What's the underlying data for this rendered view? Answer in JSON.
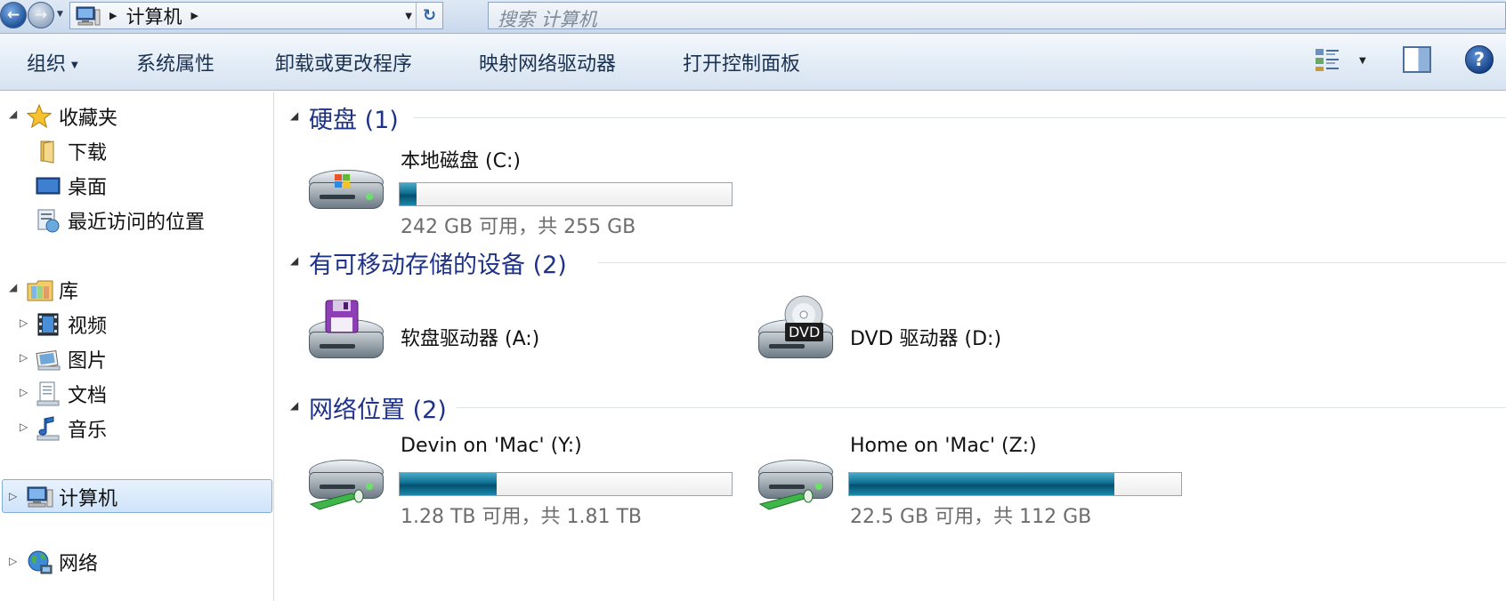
{
  "address": {
    "breadcrumb": "计算机",
    "search_placeholder": "搜索 计算机"
  },
  "toolbar": {
    "organize": "组织",
    "system_properties": "系统属性",
    "uninstall": "卸载或更改程序",
    "map_drive": "映射网络驱动器",
    "control_panel": "打开控制面板"
  },
  "nav": {
    "favorites": "收藏夹",
    "downloads": "下载",
    "desktop": "桌面",
    "recent": "最近访问的位置",
    "libraries": "库",
    "videos": "视频",
    "pictures": "图片",
    "documents": "文档",
    "music": "音乐",
    "computer": "计算机",
    "network": "网络"
  },
  "groups": {
    "hdd": "硬盘 (1)",
    "removable": "有可移动存储的设备 (2)",
    "network": "网络位置 (2)"
  },
  "drives": {
    "c": {
      "name": "本地磁盘 (C:)",
      "free": "242 GB 可用，共 255 GB",
      "used_fraction": 0.051
    },
    "a": {
      "name": "软盘驱动器 (A:)"
    },
    "d": {
      "name": "DVD 驱动器 (D:)",
      "badge": "DVD"
    },
    "y": {
      "name": "Devin on 'Mac' (Y:)",
      "free": "1.28 TB 可用，共 1.81 TB",
      "used_fraction": 0.293
    },
    "z": {
      "name": "Home on 'Mac' (Z:)",
      "free": "22.5 GB 可用，共 112 GB",
      "used_fraction": 0.8
    }
  },
  "colors": {
    "group_title": "#1e3287",
    "bar_fill": "#0d6f92"
  }
}
